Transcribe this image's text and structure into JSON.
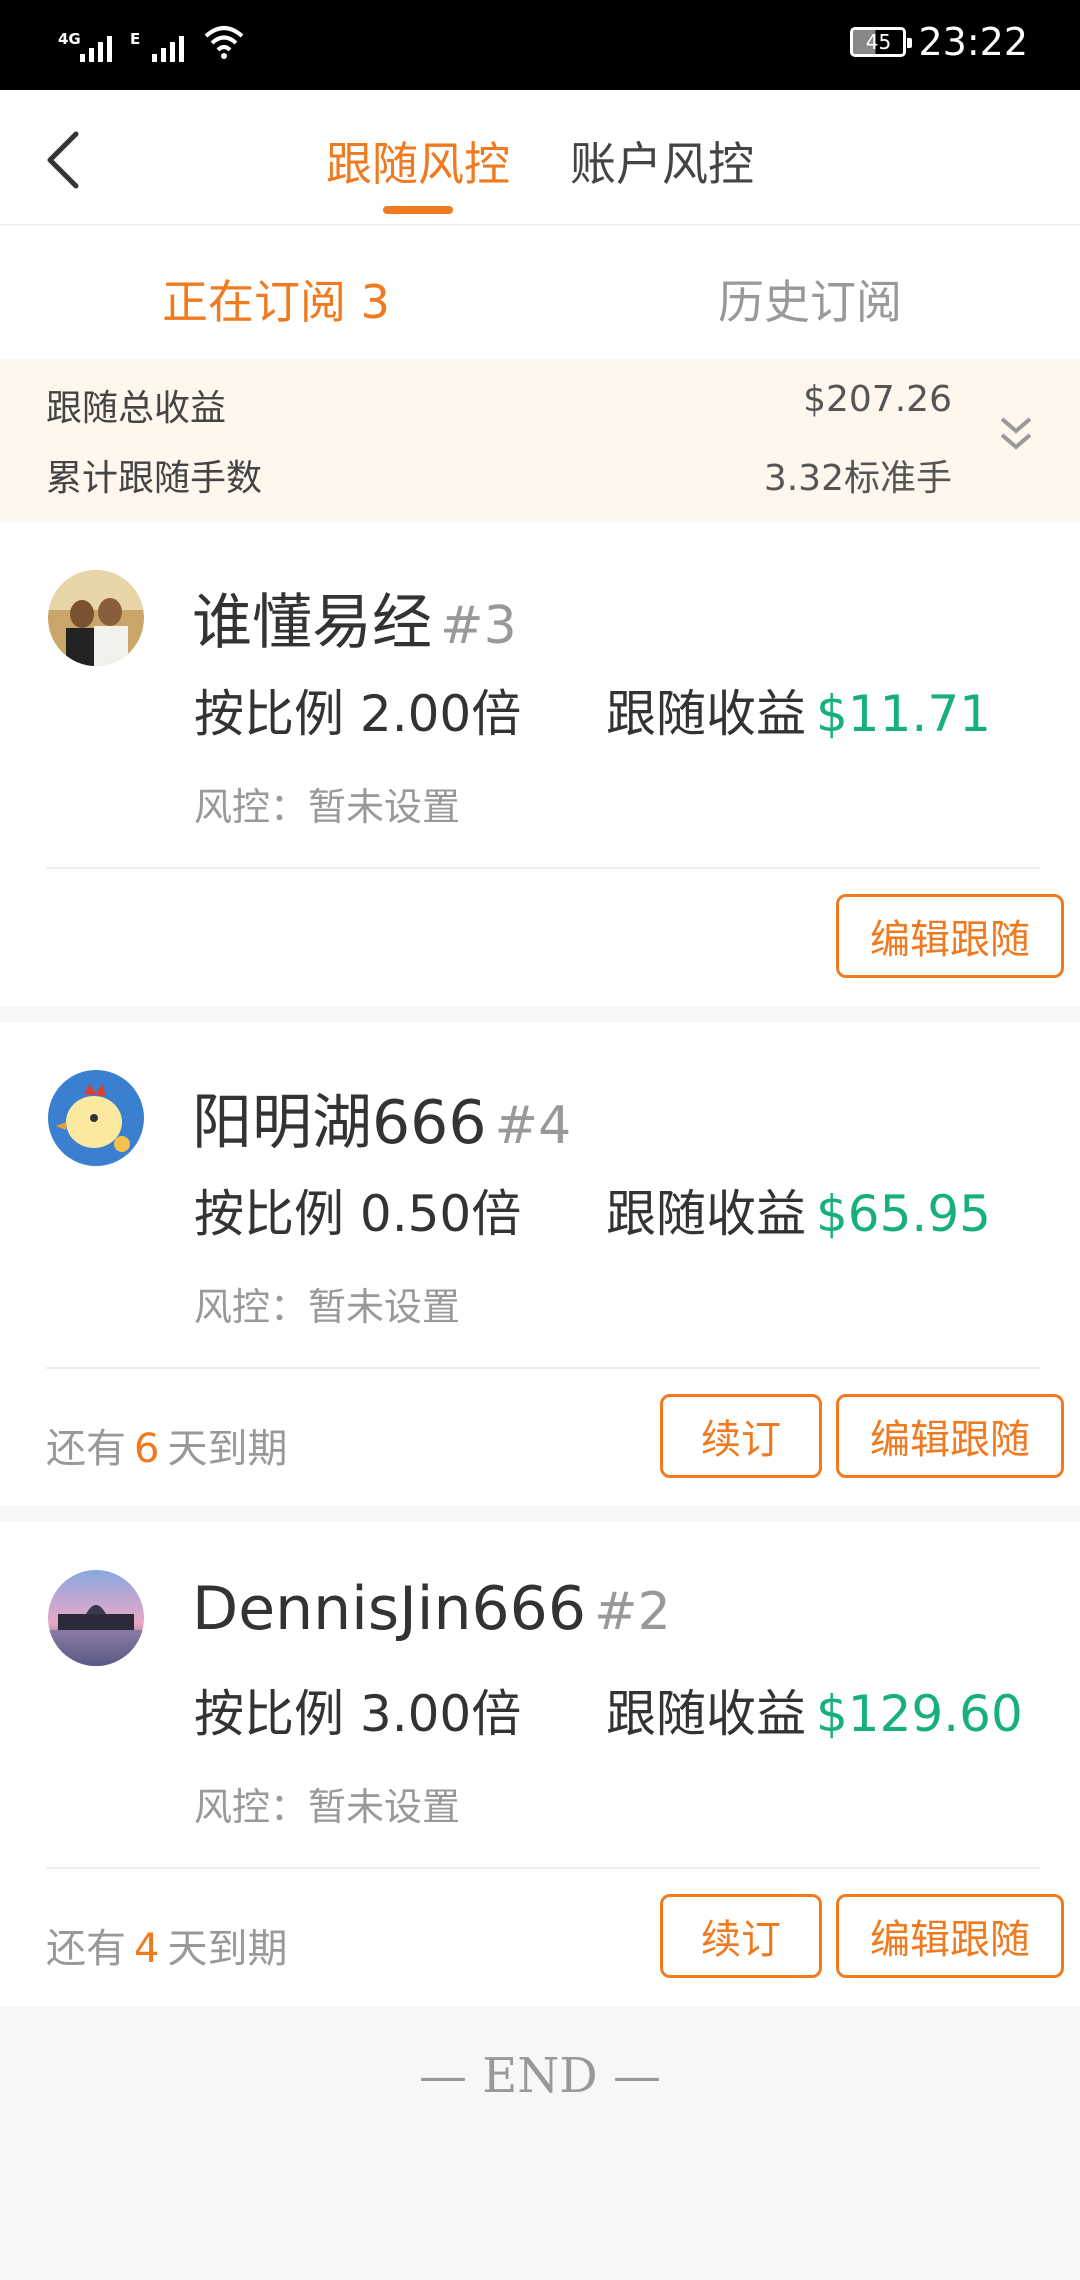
{
  "status_bar": {
    "network1": "4G",
    "network2": "E",
    "battery": "45",
    "time": "23:22"
  },
  "header": {
    "tabs": [
      {
        "label": "跟随风控",
        "active": true
      },
      {
        "label": "账户风控",
        "active": false
      }
    ]
  },
  "subtabs": {
    "current": "正在订阅 3",
    "history": "历史订阅"
  },
  "summary": {
    "total_profit_label": "跟随总收益",
    "total_profit_value": "$207.26",
    "total_lots_label": "累计跟随手数",
    "total_lots_value": "3.32标准手"
  },
  "subscriptions": [
    {
      "name": "谁懂易经",
      "rank": "#3",
      "ratio": "按比例 2.00倍",
      "profit_label": "跟随收益",
      "profit_value": "$11.71",
      "risk": "风控：暂未设置",
      "edit_label": "编辑跟随"
    },
    {
      "name": "阳明湖666",
      "rank": "#4",
      "ratio": "按比例 0.50倍",
      "profit_label": "跟随收益",
      "profit_value": "$65.95",
      "risk": "风控：暂未设置",
      "expiry_prefix": "还有",
      "expiry_days": "6",
      "expiry_suffix": "天到期",
      "renew_label": "续订",
      "edit_label": "编辑跟随"
    },
    {
      "name": "DennisJin666",
      "rank": "#2",
      "ratio": "按比例 3.00倍",
      "profit_label": "跟随收益",
      "profit_value": "$129.60",
      "risk": "风控：暂未设置",
      "expiry_prefix": "还有",
      "expiry_days": "4",
      "expiry_suffix": "天到期",
      "renew_label": "续订",
      "edit_label": "编辑跟随"
    }
  ],
  "footer": {
    "end_text": "— END —"
  },
  "colors": {
    "accent": "#f07a1f",
    "profit": "#18b07a",
    "summary_bg": "#fff6ee"
  }
}
